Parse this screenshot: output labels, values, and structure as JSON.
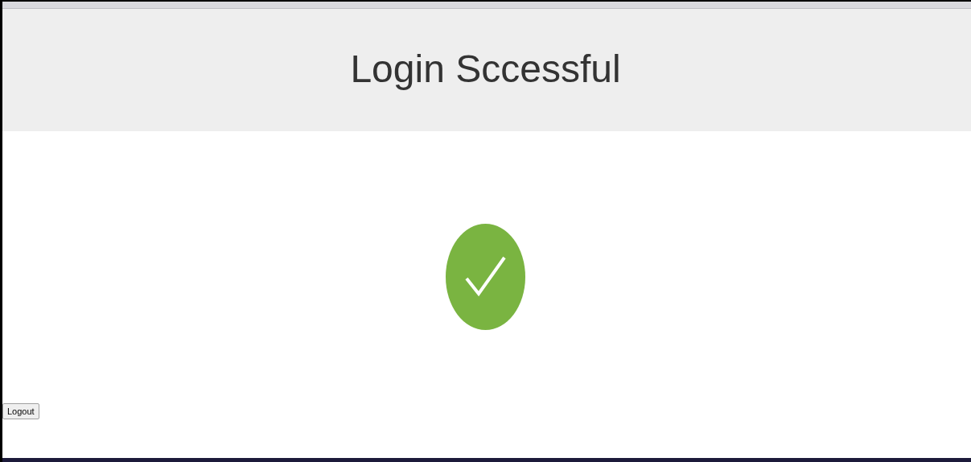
{
  "header": {
    "title": "Login Sccessful"
  },
  "status": {
    "kind": "success"
  },
  "buttons": [
    {
      "label": "Logout"
    }
  ]
}
